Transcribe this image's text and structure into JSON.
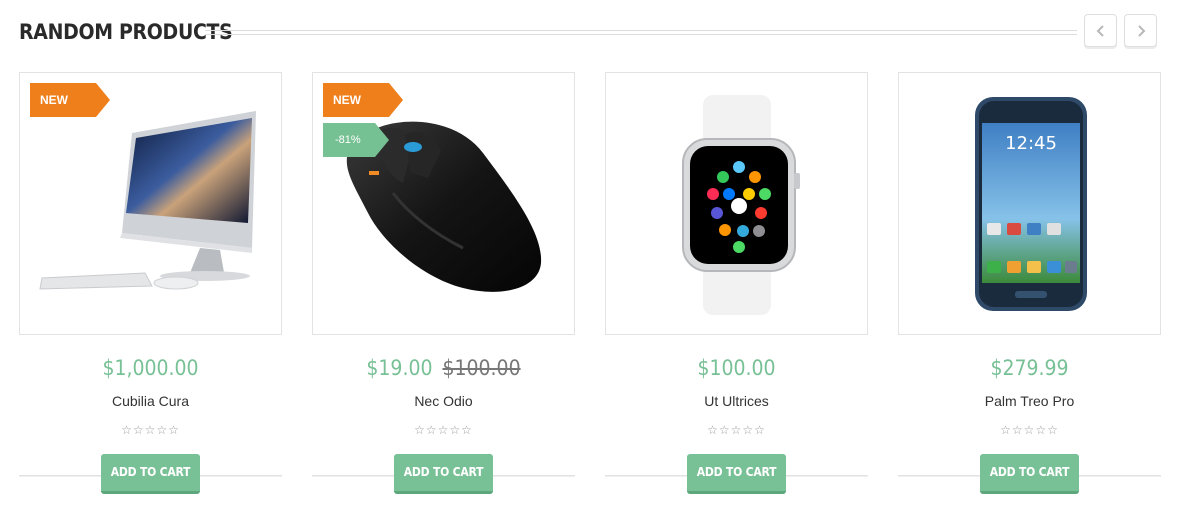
{
  "section": {
    "title": "RANDOM PRODUCTS"
  },
  "products": [
    {
      "name": "Cubilia Cura",
      "price": "$1,000.00",
      "old_price": "",
      "badge_new": "NEW",
      "badge_sale": "",
      "stars": "☆☆☆☆☆",
      "button": "ADD TO CART",
      "image_icon": "imac-computer-image"
    },
    {
      "name": "Nec Odio",
      "price": "$19.00",
      "old_price": "$100.00",
      "badge_new": "NEW",
      "badge_sale": "-81%",
      "stars": "☆☆☆☆☆",
      "button": "ADD TO CART",
      "image_icon": "gaming-mouse-image"
    },
    {
      "name": "Ut Ultrices",
      "price": "$100.00",
      "old_price": "",
      "badge_new": "",
      "badge_sale": "",
      "stars": "☆☆☆☆☆",
      "button": "ADD TO CART",
      "image_icon": "smartwatch-image"
    },
    {
      "name": "Palm Treo Pro",
      "price": "$279.99",
      "old_price": "",
      "badge_new": "",
      "badge_sale": "",
      "stars": "☆☆☆☆☆",
      "button": "ADD TO CART",
      "image_icon": "smartphone-image"
    }
  ],
  "phone_screen_time": "12:45",
  "colors": {
    "accent_green": "#78c095",
    "badge_orange": "#ef7f1a",
    "title": "#2a2a2a"
  }
}
